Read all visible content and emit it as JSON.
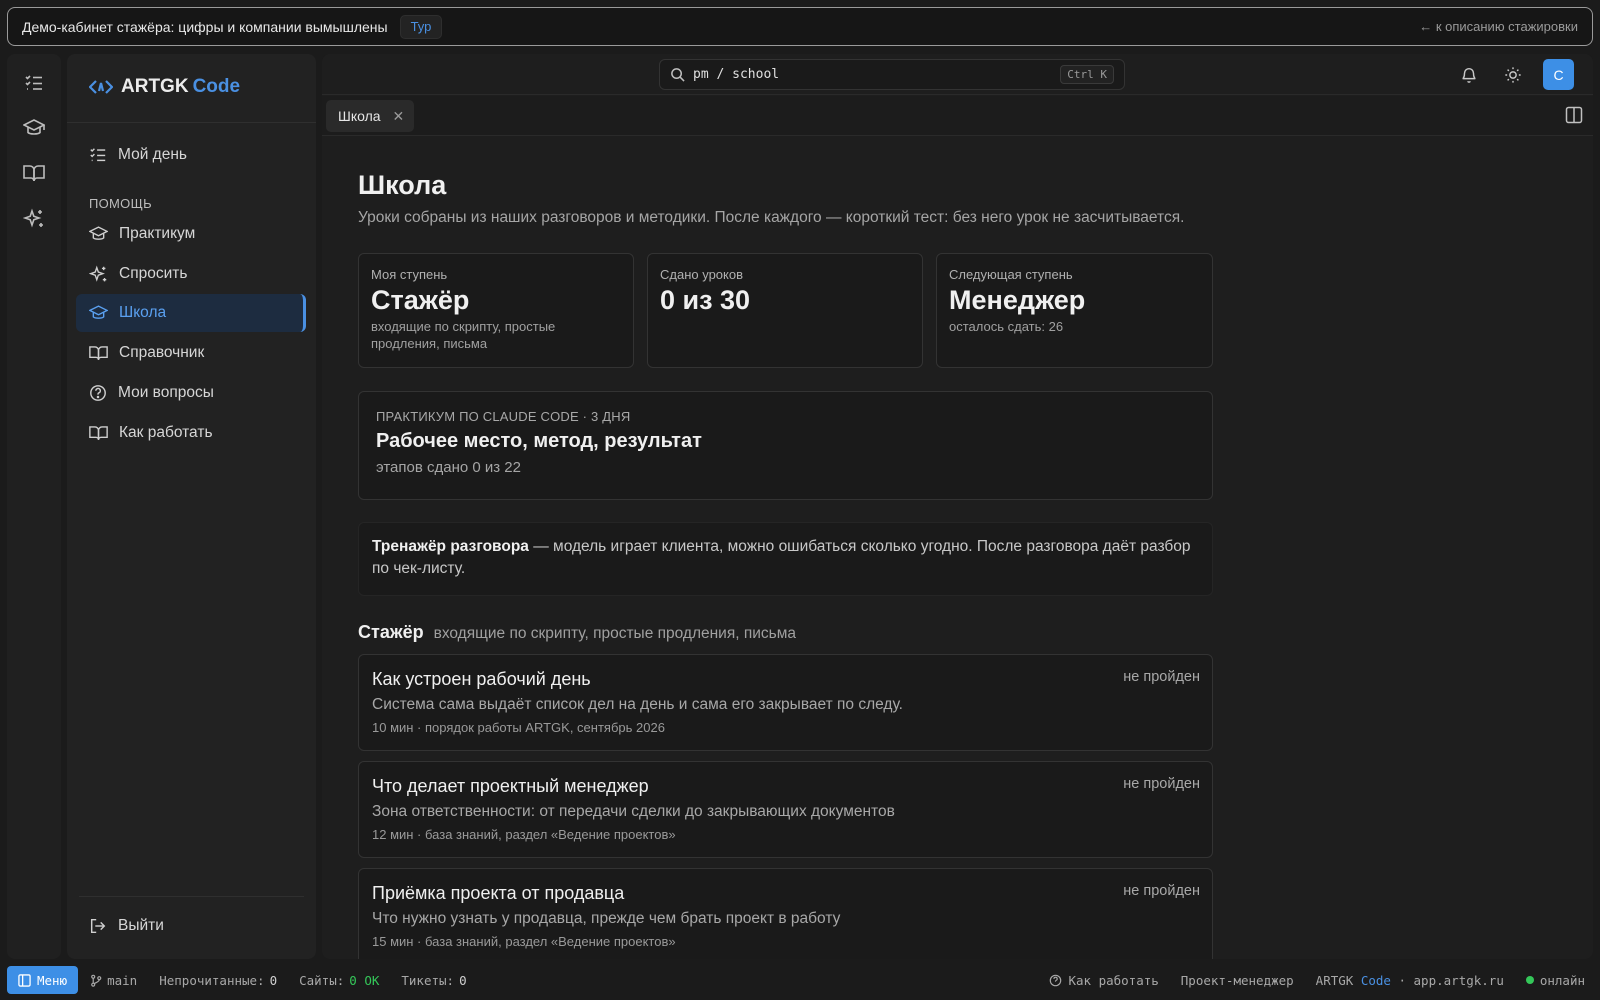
{
  "banner": {
    "text": "Демо-кабинет стажёра: цифры и компании вымышлены",
    "tour": "Тур",
    "back": "← к описанию стажировки"
  },
  "rail": {
    "icons": [
      "checklist-icon",
      "graduation-cap-icon",
      "book-icon",
      "sparkles-icon"
    ]
  },
  "logo": {
    "part1": "ARTGK",
    "part2": "Code"
  },
  "sidebar": {
    "my_day": "Мой день",
    "section": "ПОМОЩЬ",
    "items": [
      {
        "label": "Практикум",
        "icon": "graduation-cap-icon"
      },
      {
        "label": "Спросить",
        "icon": "sparkles-icon"
      },
      {
        "label": "Школа",
        "icon": "graduation-cap-icon",
        "active": true
      },
      {
        "label": "Справочник",
        "icon": "book-icon"
      },
      {
        "label": "Мои вопросы",
        "icon": "question-icon"
      },
      {
        "label": "Как работать",
        "icon": "book-icon"
      }
    ],
    "logout": "Выйти"
  },
  "topbar": {
    "search_text": "pm / school",
    "shortcut": "Ctrl K",
    "avatar": "С"
  },
  "tabs": [
    {
      "label": "Школа"
    }
  ],
  "page": {
    "title": "Школа",
    "subtitle": "Уроки собраны из наших разговоров и методики. После каждого — короткий тест: без него урок не засчитывается."
  },
  "stats": [
    {
      "label": "Моя ступень",
      "value": "Стажёр",
      "note": "входящие по скрипту, простые продления, письма"
    },
    {
      "label": "Сдано уроков",
      "value": "0 из 30",
      "note": ""
    },
    {
      "label": "Следующая ступень",
      "value": "Менеджер",
      "note": "осталось сдать: 26"
    }
  ],
  "practicum": {
    "label": "ПРАКТИКУМ ПО CLAUDE CODE · 3 ДНЯ",
    "title": "Рабочее место, метод, результат",
    "progress": "этапов сдано 0 из 22"
  },
  "trainer": {
    "bold": "Тренажёр разговора",
    "text": " — модель играет клиента, можно ошибаться сколько угодно. После разговора даёт разбор по чек-листу."
  },
  "level": {
    "title": "Стажёр",
    "desc": "входящие по скрипту, простые продления, письма"
  },
  "lessons": [
    {
      "title": "Как устроен рабочий день",
      "desc": "Система сама выдаёт список дел на день и сама его закрывает по следу.",
      "meta": "10 мин · порядок работы ARTGK, сентябрь 2026",
      "status": "не пройден"
    },
    {
      "title": "Что делает проектный менеджер",
      "desc": "Зона ответственности: от передачи сделки до закрывающих документов",
      "meta": "12 мин · база знаний, раздел «Ведение проектов»",
      "status": "не пройден"
    },
    {
      "title": "Приёмка проекта от продавца",
      "desc": "Что нужно узнать у продавца, прежде чем брать проект в работу",
      "meta": "15 мин · база знаний, раздел «Ведение проектов»",
      "status": "не пройден"
    }
  ],
  "statusbar": {
    "menu": "Меню",
    "branch": "main",
    "unread_label": "Непрочитанные:",
    "unread_value": "0",
    "sites_label": "Сайты:",
    "sites_value": "0 OK",
    "tickets_label": "Тикеты:",
    "tickets_value": "0",
    "how_to": "Как работать",
    "role": "Проект-менеджер",
    "brand_a": "ARTGK",
    "brand_b": "Code",
    "domain": "· app.artgk.ru",
    "online": "онлайн"
  },
  "colors": {
    "accent": "#4a90e2",
    "ok": "#34c759",
    "banner_border": "#9a9a9a"
  }
}
